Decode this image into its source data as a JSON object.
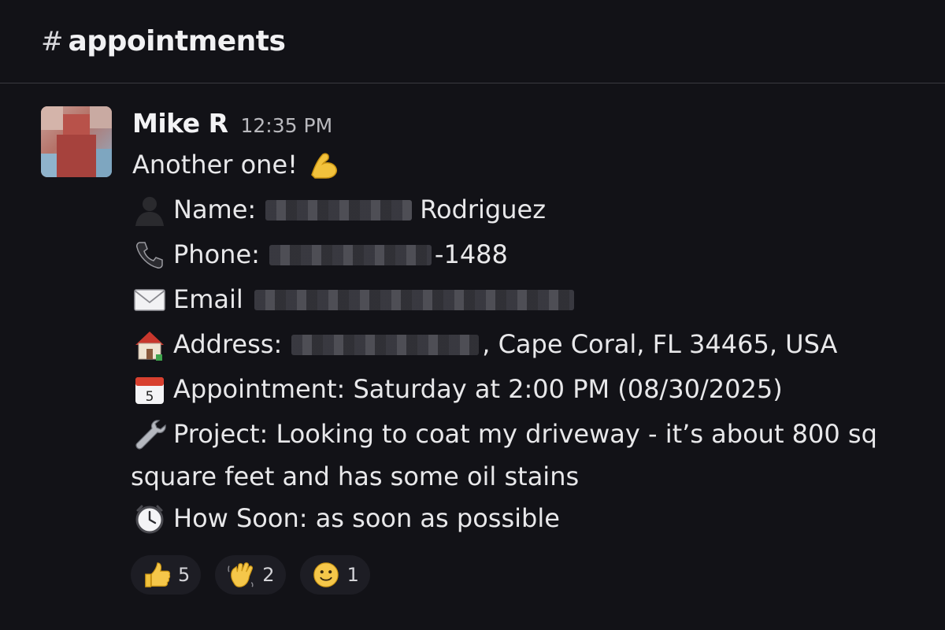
{
  "channel": {
    "hash": "#",
    "name": "appointments"
  },
  "message": {
    "author": "Mike R",
    "time": "12:35 PM",
    "intro": "Another one!",
    "name_label": "Name:",
    "name_value": "Rodriguez",
    "phone_label": "Phone:",
    "phone_value": "-1488",
    "email_label": "Email",
    "address_label": "Address:",
    "address_value": ", Cape Coral, FL  34465, USA",
    "appointment": "Appointment: Saturday at 2:00 PM (08/30/2025)",
    "project_line1": "Project: Looking to coat my driveway - it’s about 800 sq",
    "project_line2": "square feet and has some oil stains",
    "how_soon": "How Soon: as soon as possible",
    "calendar_day": "5"
  },
  "reactions": [
    {
      "icon": "thumbs-up",
      "count": "5"
    },
    {
      "icon": "waving-hand",
      "count": "2"
    },
    {
      "icon": "slightly-smiling-face",
      "count": "1"
    }
  ],
  "colors": {
    "background": "#121217",
    "text": "#e6e6e8",
    "reaction_bg": "#1d1d24",
    "divider": "#3a3a40"
  }
}
